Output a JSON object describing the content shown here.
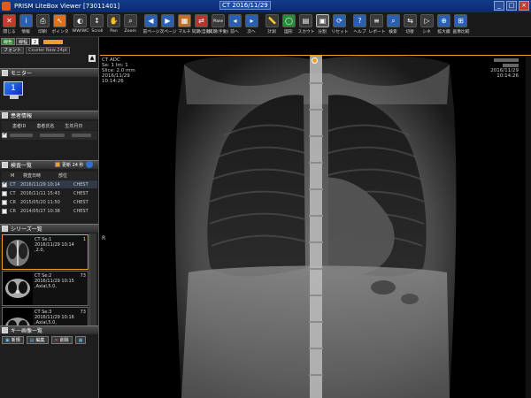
{
  "app": {
    "title": "PRISM LiteBox Viewer [73011401]",
    "study_title": "CT 2016/11/29"
  },
  "window_buttons": [
    "_",
    "□",
    "×"
  ],
  "toolbar": [
    {
      "name": "close",
      "label": "閉じる",
      "icon": "close-icon",
      "color": "#c23b2b",
      "glyph": "✕"
    },
    {
      "name": "info",
      "label": "情報",
      "icon": "info-icon",
      "color": "#2b5fb0",
      "glyph": "i"
    },
    {
      "name": "print",
      "label": "印刷",
      "icon": "print-icon",
      "color": "#3a3a3a",
      "glyph": "⎙"
    },
    {
      "name": "pointer",
      "label": "ポインタ",
      "icon": "pointer-icon",
      "color": "#e07020",
      "glyph": "↖"
    },
    {
      "name": "wwwc",
      "label": "WW/WC",
      "icon": "contrast-icon",
      "color": "#3a3a3a",
      "glyph": "◐"
    },
    {
      "name": "scroll",
      "label": "Scroll",
      "icon": "scroll-icon",
      "color": "#3a3a3a",
      "glyph": "↕"
    },
    {
      "name": "pan",
      "label": "Pan",
      "icon": "hand-icon",
      "color": "#3a3a3a",
      "glyph": "✋"
    },
    {
      "name": "zoom",
      "label": "Zoom",
      "icon": "zoom-icon",
      "color": "#3a3a3a",
      "glyph": "⌕"
    },
    {
      "name": "prev-page",
      "label": "前ページ",
      "icon": "prev-page-icon",
      "color": "#2b5fb0",
      "glyph": "◀"
    },
    {
      "name": "next-page",
      "label": "次ページ",
      "icon": "next-page-icon",
      "color": "#2b5fb0",
      "glyph": "▶"
    },
    {
      "name": "multi",
      "label": "マルチ",
      "icon": "multi-icon",
      "color": "#c07020",
      "glyph": "▦"
    },
    {
      "name": "sync-auto",
      "label": "同期(自動)",
      "icon": "sync-auto-icon",
      "color": "#c03030",
      "glyph": "⇄"
    },
    {
      "name": "sync-manual",
      "label": "同期(手動)",
      "icon": "sync-manual-icon",
      "color": "#3a3a3a",
      "glyph": "Plane"
    },
    {
      "name": "prev",
      "label": "前へ",
      "icon": "prev-icon",
      "color": "#2b5fb0",
      "glyph": "◂"
    },
    {
      "name": "next",
      "label": "次へ",
      "icon": "next-icon",
      "color": "#2b5fb0",
      "glyph": "▸"
    },
    {
      "name": "measure",
      "label": "計測",
      "icon": "ruler-icon",
      "color": "#3a3a3a",
      "glyph": "📏"
    },
    {
      "name": "shape",
      "label": "図形",
      "icon": "shape-icon",
      "color": "#2a8a3a",
      "glyph": "◯"
    },
    {
      "name": "scout",
      "label": "スカウト",
      "icon": "scout-icon",
      "color": "#3a3a3a",
      "glyph": "▤"
    },
    {
      "name": "layout",
      "label": "分割",
      "icon": "layout-icon",
      "color": "#555555",
      "glyph": "▣"
    },
    {
      "name": "reset",
      "label": "リセット",
      "icon": "reset-icon",
      "color": "#2b5fb0",
      "glyph": "⟳"
    },
    {
      "name": "help",
      "label": "ヘルプ",
      "icon": "help-icon",
      "color": "#2b5fb0",
      "glyph": "?"
    },
    {
      "name": "report",
      "label": "レポート",
      "icon": "report-icon",
      "color": "#3a3a3a",
      "glyph": "≡"
    },
    {
      "name": "search",
      "label": "検索",
      "icon": "search-icon",
      "color": "#2b5fb0",
      "glyph": "⌕"
    },
    {
      "name": "switch",
      "label": "切替",
      "icon": "switch-icon",
      "color": "#3a3a3a",
      "glyph": "⇆"
    },
    {
      "name": "cine",
      "label": "シネ",
      "icon": "cine-icon",
      "color": "#3a3a3a",
      "glyph": "▷"
    },
    {
      "name": "magnifier",
      "label": "拡大鏡",
      "icon": "magnifier-icon",
      "color": "#2b5fb0",
      "glyph": "⊕"
    },
    {
      "name": "compare",
      "label": "画像比較",
      "icon": "compare-icon",
      "color": "#2b5fb0",
      "glyph": "⊞"
    }
  ],
  "left": {
    "row1": {
      "chip1": "線色",
      "chip2": "線幅",
      "chip2_value": "2"
    },
    "row2": {
      "font_btn": "フォント",
      "font_value": "Courier New 24pt"
    },
    "sections": {
      "monitor": "モニター",
      "patient": "患者情報",
      "study": "検査一覧",
      "series": "シリーズ一覧",
      "keyimage": "キー画像一覧"
    },
    "monitor_number": "1",
    "patient_headers": [
      "患者ID",
      "患者氏名",
      "生年月日"
    ],
    "study_ctrl": {
      "label": "更新 24 秒"
    },
    "study_headers": [
      "M",
      "検査日時",
      "部位"
    ],
    "studies": [
      {
        "checked": true,
        "modality": "CT",
        "datetime": "2016/11/29 10:14",
        "part": "CHEST"
      },
      {
        "checked": false,
        "modality": "CT",
        "datetime": "2016/11/11 15:43",
        "part": "CHEST"
      },
      {
        "checked": false,
        "modality": "CR",
        "datetime": "2015/05/20 11:50",
        "part": "CHEST"
      },
      {
        "checked": false,
        "modality": "CR",
        "datetime": "2014/05/27 10:38",
        "part": "CHEST"
      }
    ],
    "series": [
      {
        "label": "CT Se:1",
        "count": "1",
        "date": "2016/11/29 10:14",
        "desc": ",2.0,"
      },
      {
        "label": "CT Se:2",
        "count": "73",
        "date": "2016/11/29 10:15",
        "desc": ",Axial,5.0,"
      },
      {
        "label": "CT Se:3",
        "count": "73",
        "date": "2016/11/29 10:16",
        "desc": ",Axial,5.0,"
      }
    ],
    "key_buttons": [
      "新規",
      "編集",
      "削除",
      ""
    ]
  },
  "viewer": {
    "overlay_tl": [
      "CT ADC",
      "Se: 1 Im: 1",
      "Slice: 2.0 mm",
      "2016/11/29",
      "10:14:26"
    ],
    "overlay_tr": [
      "2016/11/29",
      "10:14:26"
    ],
    "orient_right": "R"
  }
}
